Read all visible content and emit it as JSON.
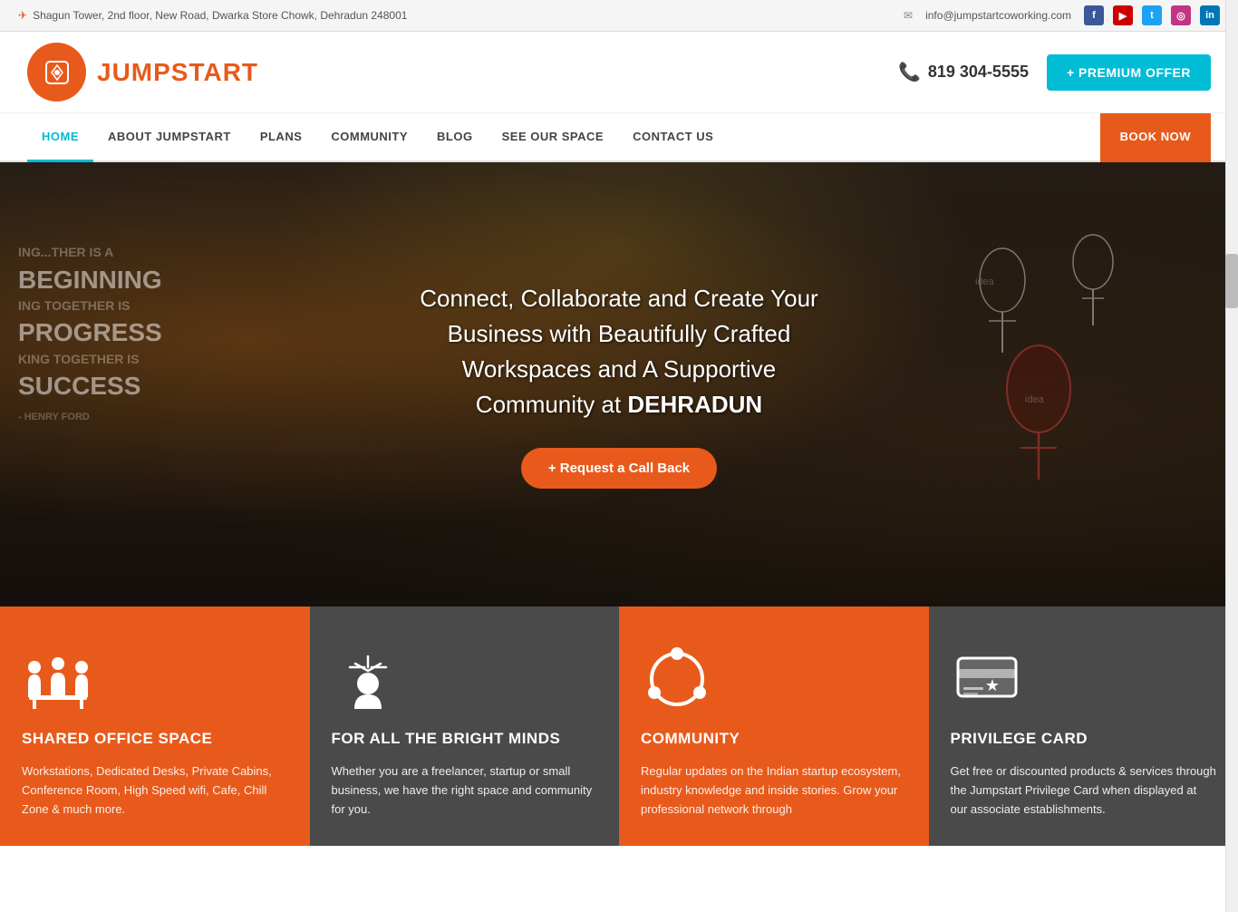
{
  "topbar": {
    "address": "Shagun Tower, 2nd floor, New Road, Dwarka Store Chowk, Dehradun 248001",
    "email": "info@jumpstartcoworking.com",
    "social": [
      "f",
      "▶",
      "t",
      "in",
      "in"
    ]
  },
  "header": {
    "logo_text": "JUMPSTART",
    "phone": "819 304-5555",
    "premium_btn": "+ PREMIUM OFFER"
  },
  "nav": {
    "items": [
      {
        "label": "HOME",
        "active": true
      },
      {
        "label": "ABOUT JUMPSTART",
        "active": false
      },
      {
        "label": "PLANS",
        "active": false
      },
      {
        "label": "COMMUNITY",
        "active": false
      },
      {
        "label": "BLOG",
        "active": false
      },
      {
        "label": "SEE OUR SPACE",
        "active": false
      },
      {
        "label": "CONTACT US",
        "active": false
      }
    ],
    "book_btn": "BOOK NOW"
  },
  "hero": {
    "title_line1": "Connect, Collaborate and Create Your",
    "title_line2": "Business with Beautifully Crafted",
    "title_line3": "Workspaces and A Supportive",
    "title_line4": "Community at ",
    "title_bold": "DEHRADUN",
    "cta": "+ Request a Call Back"
  },
  "features": [
    {
      "title": "SHARED OFFICE SPACE",
      "desc": "Workstations, Dedicated Desks, Private Cabins, Conference Room, High Speed wifi, Cafe, Chill Zone & much more.",
      "theme": "orange",
      "icon": "people-desk"
    },
    {
      "title": "FOR ALL THE BRIGHT MINDS",
      "desc": "Whether you are a freelancer, startup or small business, we have the right space and community for you.",
      "theme": "dark",
      "icon": "bright-mind"
    },
    {
      "title": "COMMUNITY",
      "desc": "Regular updates on the Indian startup ecosystem, industry knowledge and inside stories. Grow your professional network through",
      "theme": "orange",
      "icon": "community-ring"
    },
    {
      "title": "PRIVILEGE CARD",
      "desc": "Get free or discounted products & services through the Jumpstart Privilege Card when displayed at our associate establishments.",
      "theme": "dark",
      "icon": "privilege-card"
    }
  ]
}
